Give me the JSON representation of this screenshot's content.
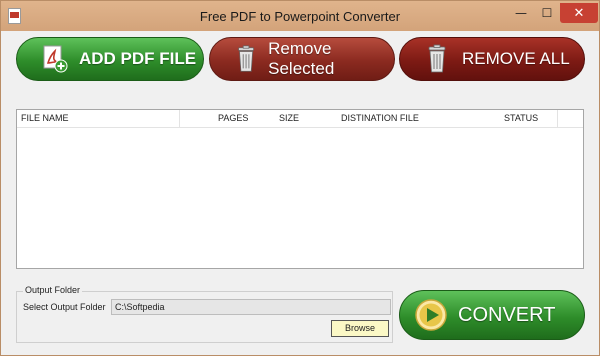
{
  "window": {
    "title": "Free PDF to Powerpoint Converter",
    "controls": {
      "minimize": "—",
      "maximize": "☐",
      "close": "✕"
    }
  },
  "toolbar": {
    "add_label": "ADD PDF FILE",
    "remove_selected_label": "Remove Selected",
    "remove_all_label": "REMOVE ALL"
  },
  "table": {
    "columns": [
      "FILE NAME",
      "PAGES",
      "SIZE",
      "DISTINATION FILE",
      "STATUS"
    ],
    "rows": []
  },
  "output": {
    "group_title": "Output Folder",
    "select_label": "Select Output Folder",
    "path_value": "C:\\Softpedia",
    "browse_label": "Browse"
  },
  "convert": {
    "label": "CONVERT"
  },
  "colors": {
    "green": "#2e8d2a",
    "red": "#8b2a20",
    "dark_red": "#7d1a14",
    "titlebar": "#d9aa80"
  },
  "icons": {
    "add": "pdf-add-icon",
    "remove": "trash-icon",
    "convert": "play-icon"
  }
}
